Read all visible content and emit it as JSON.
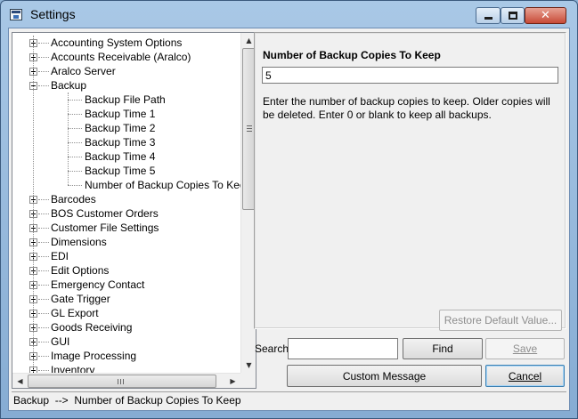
{
  "window": {
    "title": "Settings"
  },
  "tree": {
    "items": [
      {
        "label": "Accounting System Options",
        "level": 0,
        "expander": "plus"
      },
      {
        "label": "Accounts Receivable (Aralco)",
        "level": 0,
        "expander": "plus"
      },
      {
        "label": "Aralco Server",
        "level": 0,
        "expander": "plus"
      },
      {
        "label": "Backup",
        "level": 0,
        "expander": "minus"
      },
      {
        "label": "Backup File Path",
        "level": 1
      },
      {
        "label": "Backup Time 1",
        "level": 1
      },
      {
        "label": "Backup Time 2",
        "level": 1
      },
      {
        "label": "Backup Time 3",
        "level": 1
      },
      {
        "label": "Backup Time 4",
        "level": 1
      },
      {
        "label": "Backup Time 5",
        "level": 1
      },
      {
        "label": "Number of Backup Copies To Keep",
        "level": 1
      },
      {
        "label": "Barcodes",
        "level": 0,
        "expander": "plus"
      },
      {
        "label": "BOS Customer Orders",
        "level": 0,
        "expander": "plus"
      },
      {
        "label": "Customer File Settings",
        "level": 0,
        "expander": "plus"
      },
      {
        "label": "Dimensions",
        "level": 0,
        "expander": "plus"
      },
      {
        "label": "EDI",
        "level": 0,
        "expander": "plus"
      },
      {
        "label": "Edit Options",
        "level": 0,
        "expander": "plus"
      },
      {
        "label": "Emergency Contact",
        "level": 0,
        "expander": "plus"
      },
      {
        "label": "Gate Trigger",
        "level": 0,
        "expander": "plus"
      },
      {
        "label": "GL Export",
        "level": 0,
        "expander": "plus"
      },
      {
        "label": "Goods Receiving",
        "level": 0,
        "expander": "plus"
      },
      {
        "label": "GUI",
        "level": 0,
        "expander": "plus"
      },
      {
        "label": "Image Processing",
        "level": 0,
        "expander": "plus"
      },
      {
        "label": "Inventory",
        "level": 0,
        "expander": "plus"
      }
    ]
  },
  "setting": {
    "title": "Number of Backup Copies To Keep",
    "value": "5",
    "description": "Enter the number of backup copies to keep. Older copies will be deleted. Enter 0 or blank to keep all backups."
  },
  "buttons": {
    "restore": "Restore Default Value...",
    "find": "Find",
    "save": "Save",
    "custom_message": "Custom Message",
    "cancel": "Cancel"
  },
  "search": {
    "label": "Search",
    "value": ""
  },
  "status": {
    "path": "Backup  -->  Number of Backup Copies To Keep"
  },
  "icons": {
    "app": "settings-window-icon",
    "minimize": "minimize-icon",
    "maximize": "maximize-icon",
    "close": "close-icon",
    "expander": "tree-expander-icon",
    "scroll_up": "scroll-up-arrow-icon",
    "scroll_down": "scroll-down-arrow-icon",
    "scroll_left": "scroll-left-arrow-icon",
    "scroll_right": "scroll-right-arrow-icon"
  },
  "colors": {
    "titlebar": "#a9c8e6",
    "close_button": "#c74a37",
    "disabled_text": "#8d8d8d"
  }
}
